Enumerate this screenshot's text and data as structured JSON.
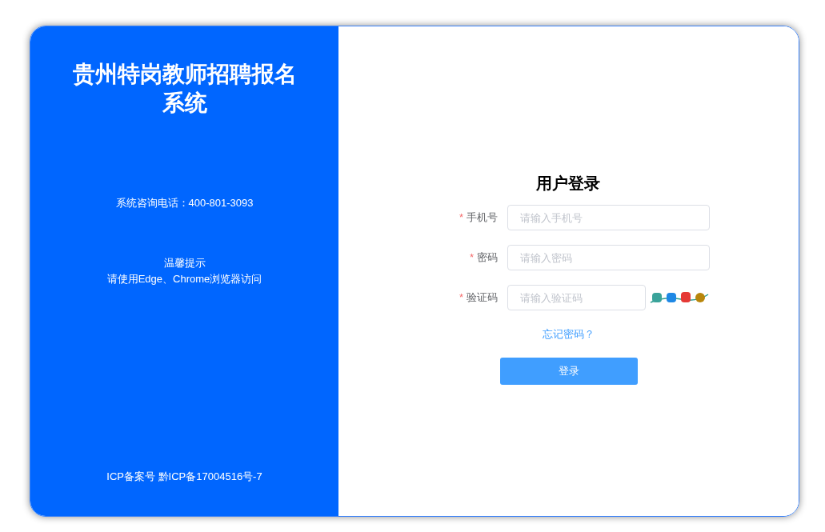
{
  "left_panel": {
    "title": "贵州特岗教师招聘报名系统",
    "phone": "系统咨询电话：400-801-3093",
    "tip_title": "温馨提示",
    "tip_text": "请使用Edge、Chrome浏览器访问",
    "icp": "ICP备案号 黔ICP备17004516号-7"
  },
  "login": {
    "heading": "用户登录",
    "fields": [
      {
        "kind": "text",
        "label": "手机号",
        "required_mark": "*",
        "placeholder": "请输入手机号"
      },
      {
        "kind": "text",
        "label": "密码",
        "required_mark": "*",
        "placeholder": "请输入密码"
      },
      {
        "kind": "captcha",
        "label": "验证码",
        "required_mark": "*",
        "placeholder": "请输入验证码"
      }
    ],
    "forgot_link": "忘记密码？",
    "submit": "登录"
  }
}
